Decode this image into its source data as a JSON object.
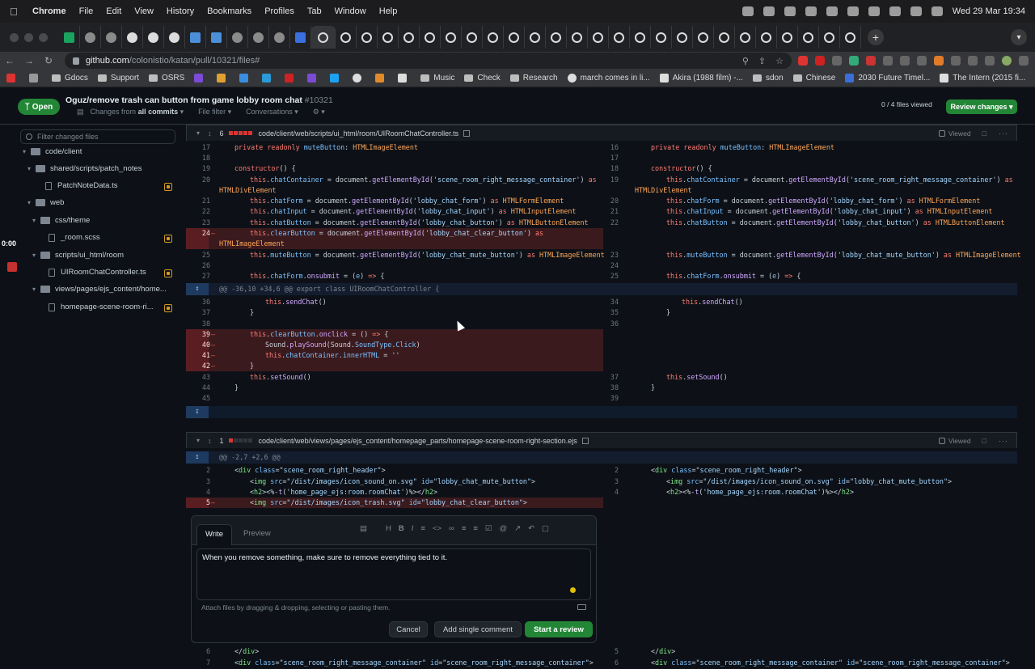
{
  "menubar": {
    "app": "Chrome",
    "items": [
      "File",
      "Edit",
      "View",
      "History",
      "Bookmarks",
      "Profiles",
      "Tab",
      "Window",
      "Help"
    ],
    "clock": "Wed 29 Mar  19:34"
  },
  "browser": {
    "url_host": "github.com",
    "url_path": "/colonistio/katan/pull/10321/files#"
  },
  "bookmarks": [
    "Gdocs",
    "Support",
    "OSRS",
    "Music",
    "Check",
    "Research",
    "march comes in li...",
    "Akira (1988 film) -...",
    "sdon",
    "Chinese",
    "2030 Future Timel...",
    "The Intern (2015 fi..."
  ],
  "pr": {
    "status": "Open",
    "title": "Oguz/remove trash can button from game lobby room chat",
    "number": "#10321",
    "changes_from": "Changes from",
    "all_commits": "all commits",
    "file_filter": "File filter",
    "conversations": "Conversations",
    "files_viewed": "0 / 4 files viewed",
    "review_button": "Review changes"
  },
  "sidebar": {
    "filter_placeholder": "Filter changed files",
    "tree": [
      {
        "label": "code/client",
        "type": "folder"
      },
      {
        "label": "shared/scripts/patch_notes",
        "type": "folder"
      },
      {
        "label": "PatchNoteData.ts",
        "type": "file"
      },
      {
        "label": "web",
        "type": "folder"
      },
      {
        "label": "css/theme",
        "type": "folder"
      },
      {
        "label": "_room.scss",
        "type": "file"
      },
      {
        "label": "scripts/ui_html/room",
        "type": "folder"
      },
      {
        "label": "UIRoomChatController.ts",
        "type": "file"
      },
      {
        "label": "views/pages/ejs_content/home...",
        "type": "folder"
      },
      {
        "label": "homepage-scene-room-ri...",
        "type": "file"
      }
    ],
    "timer": "0:00"
  },
  "file1": {
    "count": "6",
    "path": "code/client/web/scripts/ui_html/room/UIRoomChatController.ts",
    "viewed": "Viewed",
    "hunk": "@@ -36,10 +34,6 @@ export class UIRoomChatController {"
  },
  "file2": {
    "count": "1",
    "path": "code/client/web/views/pages/ejs_content/homepage_parts/homepage-scene-room-right-section.ejs",
    "viewed": "Viewed",
    "hunk": "@@ -2,7 +2,6 @@"
  },
  "comment": {
    "tab_write": "Write",
    "tab_preview": "Preview",
    "text": "When you remove something, make sure to remove everything tied to it.",
    "attach_hint": "Attach files by dragging & dropping, selecting or pasting them.",
    "cancel": "Cancel",
    "add_single": "Add single comment",
    "start_review": "Start a review"
  }
}
